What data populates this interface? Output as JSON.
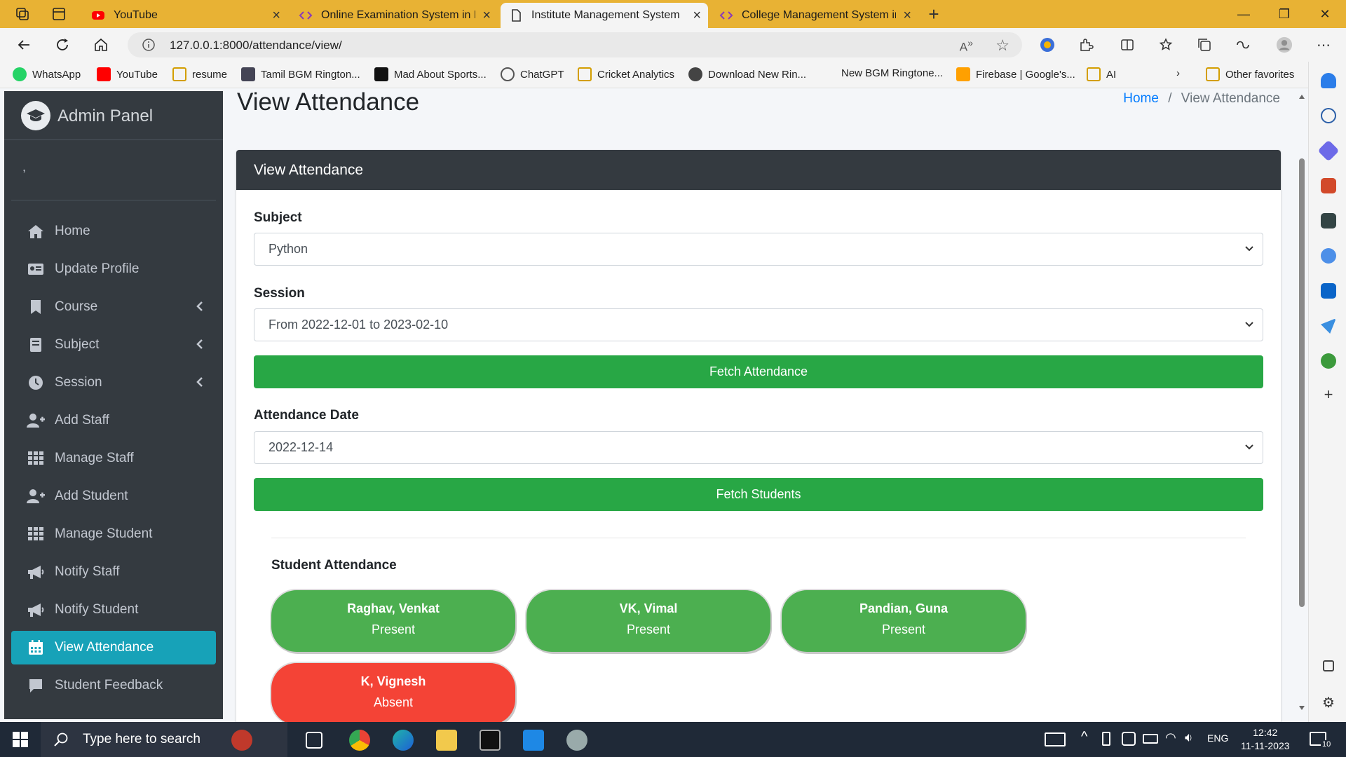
{
  "browser": {
    "tabs": [
      {
        "title": "YouTube",
        "active": false
      },
      {
        "title": "Online Examination System in Py",
        "active": false
      },
      {
        "title": "Institute Management System",
        "active": true
      },
      {
        "title": "College Management System in",
        "active": false
      }
    ],
    "url": "127.0.0.1:8000/attendance/view/",
    "bookmarks": [
      "WhatsApp",
      "YouTube",
      "resume",
      "Tamil BGM Rington...",
      "Mad About Sports...",
      "ChatGPT",
      "Cricket Analytics",
      "Download New Rin...",
      "New BGM Ringtone...",
      "Firebase | Google's...",
      "AI",
      "Other favorites"
    ]
  },
  "sidebar": {
    "brand": "Admin Panel",
    "user": ",",
    "items": [
      {
        "label": "Home",
        "icon": "home-icon"
      },
      {
        "label": "Update Profile",
        "icon": "id-card-icon"
      },
      {
        "label": "Course",
        "icon": "bookmark-icon"
      },
      {
        "label": "Subject",
        "icon": "book-icon"
      },
      {
        "label": "Session",
        "icon": "clock-icon"
      },
      {
        "label": "Add Staff",
        "icon": "user-plus-icon"
      },
      {
        "label": "Manage Staff",
        "icon": "grid-icon"
      },
      {
        "label": "Add Student",
        "icon": "user-plus-icon"
      },
      {
        "label": "Manage Student",
        "icon": "grid-icon"
      },
      {
        "label": "Notify Staff",
        "icon": "megaphone-icon"
      },
      {
        "label": "Notify Student",
        "icon": "megaphone-icon"
      },
      {
        "label": "View Attendance",
        "icon": "calendar-icon"
      },
      {
        "label": "Student Feedback",
        "icon": "comment-icon"
      }
    ]
  },
  "header": {
    "title": "View Attendance",
    "breadcrumb_home": "Home",
    "breadcrumb_sep": "/",
    "breadcrumb_current": "View Attendance"
  },
  "card": {
    "title": "View Attendance",
    "subject_label": "Subject",
    "subject_value": "Python",
    "session_label": "Session",
    "session_value": "From 2022-12-01 to 2023-02-10",
    "fetch_attendance": "Fetch Attendance",
    "date_label": "Attendance Date",
    "date_value": "2022-12-14",
    "fetch_students": "Fetch Students",
    "student_attendance_title": "Student Attendance",
    "students": [
      {
        "name": "Raghav, Venkat",
        "status": "Present"
      },
      {
        "name": "VK, Vimal",
        "status": "Present"
      },
      {
        "name": "Pandian, Guna",
        "status": "Present"
      },
      {
        "name": "K, Vignesh",
        "status": "Absent"
      }
    ]
  },
  "taskbar": {
    "search_placeholder": "Type here to search",
    "language": "ENG",
    "time": "12:42",
    "date": "11-11-2023",
    "notifications": "10"
  },
  "colors": {
    "accent": "#17a2b8",
    "present": "#4caf50",
    "absent": "#f44336",
    "button": "#28a745",
    "sidebar": "#343a40",
    "tabstrip": "#e8b234"
  }
}
